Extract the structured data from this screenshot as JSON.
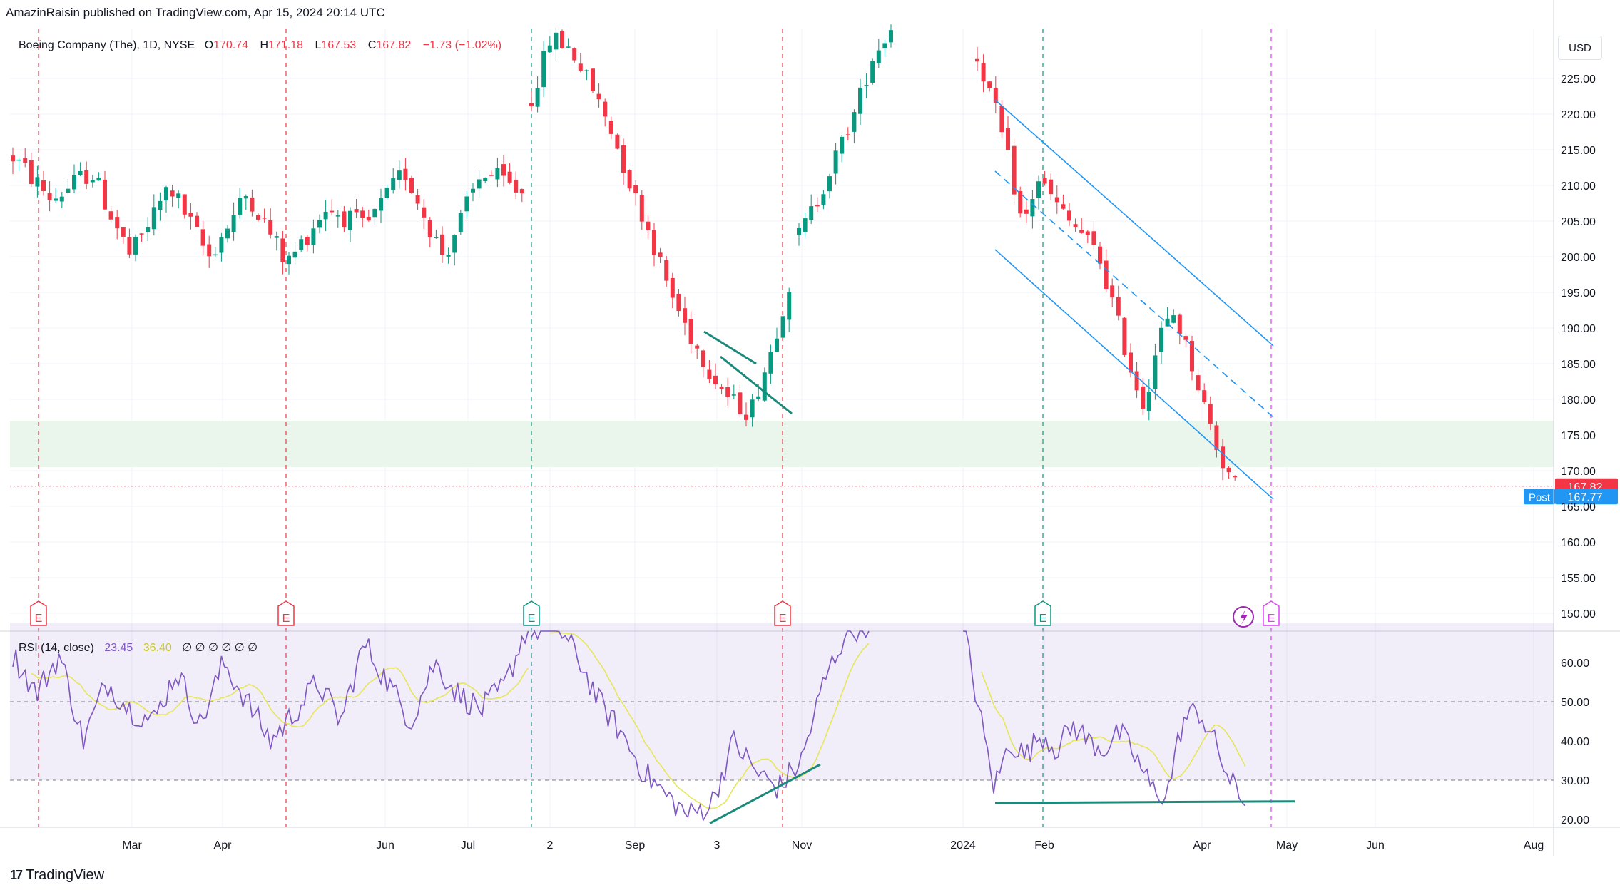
{
  "header": {
    "publisher_line": "AmazinRaisin published on TradingView.com, Apr 15, 2024 20:14 UTC"
  },
  "legend": {
    "symbol": "Boeing Company (The), 1D, NYSE",
    "open_label": "O",
    "open": "170.74",
    "high_label": "H",
    "high": "171.18",
    "low_label": "L",
    "low": "167.53",
    "close_label": "C",
    "close": "167.82",
    "change": "−1.73 (−1.02%)"
  },
  "rsi_legend": {
    "label": "RSI (14, close)",
    "value": "23.45",
    "ma_value": "36.40",
    "extra": "∅ ∅ ∅ ∅ ∅ ∅"
  },
  "currency_button": "USD",
  "footer": {
    "brand": "TradingView",
    "mark": "17"
  },
  "colors": {
    "up": "#089981",
    "down": "#f23645",
    "rsi_line": "#7e57c2",
    "rsi_ma": "#e6e65a",
    "channel": "#2196f3",
    "support_zone": "#e8f5e9",
    "trendline": "#1b8a7a",
    "earnings_red": "#f23645",
    "earnings_green": "#089981",
    "earnings_purple": "#e040fb"
  },
  "chart_data": [
    {
      "type": "candlestick",
      "title": "Boeing Company (The), 1D, NYSE",
      "y_range": [
        148,
        232
      ],
      "y_ticks": [
        "225.00",
        "220.00",
        "215.00",
        "210.00",
        "205.00",
        "200.00",
        "195.00",
        "190.00",
        "185.00",
        "180.00",
        "175.00",
        "170.00",
        "165.00",
        "160.00",
        "155.00",
        "150.00"
      ],
      "y_tick_values": [
        225,
        220,
        215,
        210,
        205,
        200,
        195,
        190,
        185,
        180,
        175,
        170,
        165,
        160,
        155,
        150
      ],
      "x_labels": [
        "Mar",
        "Apr",
        "Jun",
        "Jul",
        "2",
        "Sep",
        "3",
        "Nov",
        "2024",
        "Feb",
        "Apr",
        "May",
        "Jun",
        "Aug"
      ],
      "last_price": {
        "label": "167.82",
        "value": 167.82
      },
      "post_price": {
        "tag": "Post",
        "label": "167.77",
        "value": 167.77
      },
      "support_zone": [
        170.5,
        177
      ],
      "earnings_markers": [
        {
          "label": "E",
          "status": "past-miss"
        },
        {
          "label": "E",
          "status": "past-miss"
        },
        {
          "label": "E",
          "status": "past-beat"
        },
        {
          "label": "E",
          "status": "past-miss"
        },
        {
          "label": "E",
          "status": "past-beat"
        },
        {
          "label": "E",
          "status": "upcoming"
        }
      ],
      "dividend_marker": {
        "icon": "lightning-icon"
      },
      "segments": [
        {
          "start_price": 214,
          "waypoints": [
            208,
            212,
            200,
            210,
            200,
            209,
            199,
            207,
            204,
            212,
            200,
            212,
            209
          ],
          "volatility": 3.2
        },
        {
          "start_price": 222,
          "waypoints": [
            231,
            229,
            224,
            218,
            210,
            203,
            195,
            189,
            184,
            180,
            178,
            186,
            196
          ]
        },
        {
          "start_price": 203,
          "waypoints": [
            208,
            214,
            220,
            228,
            232
          ]
        },
        {
          "start_price": 228,
          "waypoints": [
            222,
            214,
            204,
            211,
            208,
            205,
            203,
            200,
            193,
            185,
            179,
            189,
            192,
            186,
            179,
            172,
            168
          ]
        }
      ],
      "channel": {
        "upper": [
          [
            0,
            222
          ],
          [
            1,
            187.5
          ]
        ],
        "middle": [
          [
            0,
            212
          ],
          [
            1,
            177.5
          ]
        ],
        "lower": [
          [
            0,
            201
          ],
          [
            1,
            166
          ]
        ]
      },
      "notes": "Descending parallel channel from Jan 2024 to late Apr; support zone 170.5–177."
    },
    {
      "type": "line",
      "title": "RSI (14, close)",
      "y_range": [
        18,
        68
      ],
      "y_ticks": [
        "60.00",
        "50.00",
        "40.00",
        "30.00",
        "20.00"
      ],
      "y_tick_values": [
        60,
        50,
        40,
        30,
        20
      ],
      "bands": [
        30,
        70
      ],
      "dashed_levels": [
        30,
        50
      ],
      "series": [
        {
          "name": "RSI",
          "last": 23.45
        },
        {
          "name": "RSI MA",
          "last": 36.4
        }
      ],
      "segments": [
        {
          "waypoints": [
            62,
            52,
            62,
            40,
            55,
            48,
            45,
            58,
            44,
            60,
            50,
            40,
            47,
            55,
            45,
            65,
            55,
            45,
            60,
            52,
            48,
            54,
            70
          ]
        },
        {
          "waypoints": [
            68,
            70,
            62,
            50,
            42,
            32,
            26,
            21,
            24,
            40,
            32,
            28,
            35,
            55,
            68,
            70
          ]
        },
        {
          "waypoints": [
            70,
            48,
            28,
            40,
            36,
            42,
            38,
            44,
            40,
            38,
            42,
            36,
            28,
            26,
            45,
            48,
            40,
            30,
            23.45
          ]
        }
      ],
      "annotations": [
        "divergence trendline Oct 2023",
        "flat support trendline Jan–Apr 2024"
      ]
    }
  ]
}
